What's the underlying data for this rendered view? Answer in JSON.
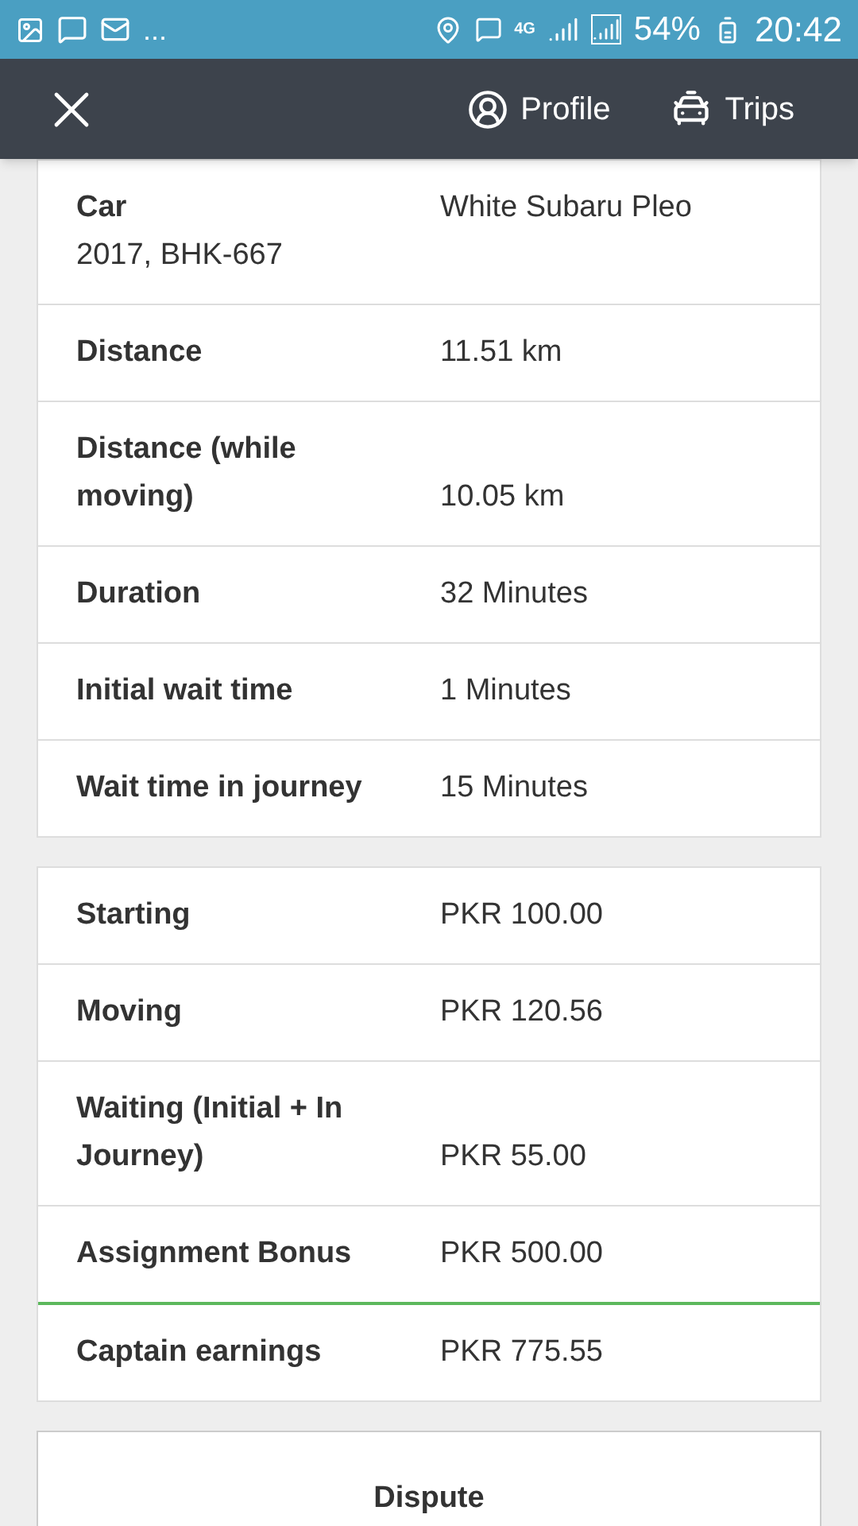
{
  "status_bar": {
    "more": "...",
    "network": "4G",
    "battery": "54%",
    "time": "20:42"
  },
  "nav": {
    "items": [
      {
        "label": "Profile",
        "kind": "profile"
      },
      {
        "label": "Trips",
        "kind": "trips"
      }
    ]
  },
  "sections": [
    {
      "rows": [
        {
          "label": "Car",
          "sublabel": "2017, BHK-667",
          "value": "White Subaru Pleo",
          "total": false
        },
        {
          "label": "Distance",
          "value": "11.51 km",
          "total": false
        },
        {
          "label": "Distance (while moving)",
          "value": "10.05 km",
          "total": false
        },
        {
          "label": "Duration",
          "value": "32 Minutes",
          "total": false
        },
        {
          "label": "Initial wait time",
          "value": "1 Minutes",
          "total": false
        },
        {
          "label": "Wait time in journey",
          "value": "15 Minutes",
          "total": false
        }
      ]
    },
    {
      "rows": [
        {
          "label": "Starting",
          "value": "PKR 100.00",
          "total": false
        },
        {
          "label": "Moving",
          "value": "PKR 120.56",
          "total": false
        },
        {
          "label": "Waiting (Initial + In Journey)",
          "value": "PKR 55.00",
          "total": false
        },
        {
          "label": "Assignment Bonus",
          "value": "PKR 500.00",
          "total": false
        },
        {
          "label": "Captain earnings",
          "value": "PKR 775.55",
          "total": true
        }
      ]
    }
  ],
  "dispute_button": "Dispute"
}
